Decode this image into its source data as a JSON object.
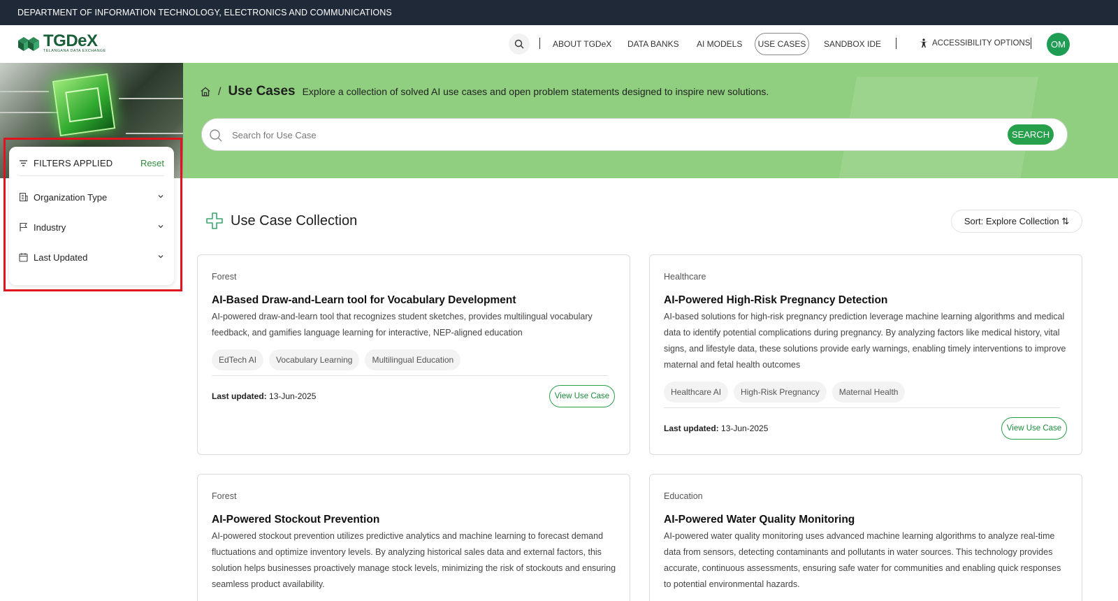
{
  "topbar": {
    "dept": "DEPARTMENT OF INFORMATION TECHNOLOGY, ELECTRONICS AND COMMUNICATIONS"
  },
  "logo": {
    "title": "TGDeX",
    "subtitle": "TELANGANA DATA EXCHANGE"
  },
  "nav": {
    "items": [
      "ABOUT TGDeX",
      "DATA BANKS",
      "AI MODELS",
      "USE CASES",
      "SANDBOX IDE"
    ],
    "active": "USE CASES",
    "accessibility": "ACCESSIBILITY OPTIONS",
    "avatar_initials": "OM"
  },
  "banner": {
    "breadcrumb_sep": "/",
    "title": "Use Cases",
    "description": "Explore a collection of solved AI use cases and open problem statements designed to inspire new solutions.",
    "search_placeholder": "Search for Use Case",
    "search_button": "SEARCH"
  },
  "filters": {
    "title": "FILTERS APPLIED",
    "reset": "Reset",
    "items": [
      "Organization Type",
      "Industry",
      "Last Updated"
    ]
  },
  "collection": {
    "title": "Use Case Collection",
    "sort_label": "Sort: Explore Collection ⇅"
  },
  "cards": [
    {
      "industry": "Forest",
      "title": "AI-Based Draw-and-Learn tool for Vocabulary Development",
      "description": "AI-powered draw-and-learn tool that recognizes student sketches, provides multilingual vocabulary feedback, and gamifies language learning for interactive, NEP-aligned education",
      "tags": [
        "EdTech AI",
        "Vocabulary Learning",
        "Multilingual Education"
      ],
      "updated_label": "Last updated:",
      "updated_value": "13-Jun-2025",
      "button": "View Use Case"
    },
    {
      "industry": "Healthcare",
      "title": "AI-Powered High-Risk Pregnancy Detection",
      "description": "AI-based solutions for high-risk pregnancy prediction leverage machine learning algorithms and medical data to identify potential complications during pregnancy. By analyzing factors like medical history, vital signs, and lifestyle data, these solutions provide early warnings, enabling timely interventions to improve maternal and fetal health outcomes",
      "tags": [
        "Healthcare AI",
        "High-Risk Pregnancy",
        "Maternal Health"
      ],
      "updated_label": "Last updated:",
      "updated_value": "13-Jun-2025",
      "button": "View Use Case"
    },
    {
      "industry": "Forest",
      "title": "AI-Powered Stockout Prevention",
      "description": "AI-powered stockout prevention utilizes predictive analytics and machine learning to forecast demand fluctuations and optimize inventory levels. By analyzing historical sales data and external factors, this solution helps businesses proactively manage stock levels, minimizing the risk of stockouts and ensuring seamless product availability."
    },
    {
      "industry": "Education",
      "title": "AI-Powered Water Quality Monitoring",
      "description": "AI-powered water quality monitoring uses advanced machine learning algorithms to analyze real-time data from sensors, detecting contaminants and pollutants in water sources. This technology provides accurate, continuous assessments, ensuring safe water for communities and enabling quick responses to potential environmental hazards."
    }
  ]
}
